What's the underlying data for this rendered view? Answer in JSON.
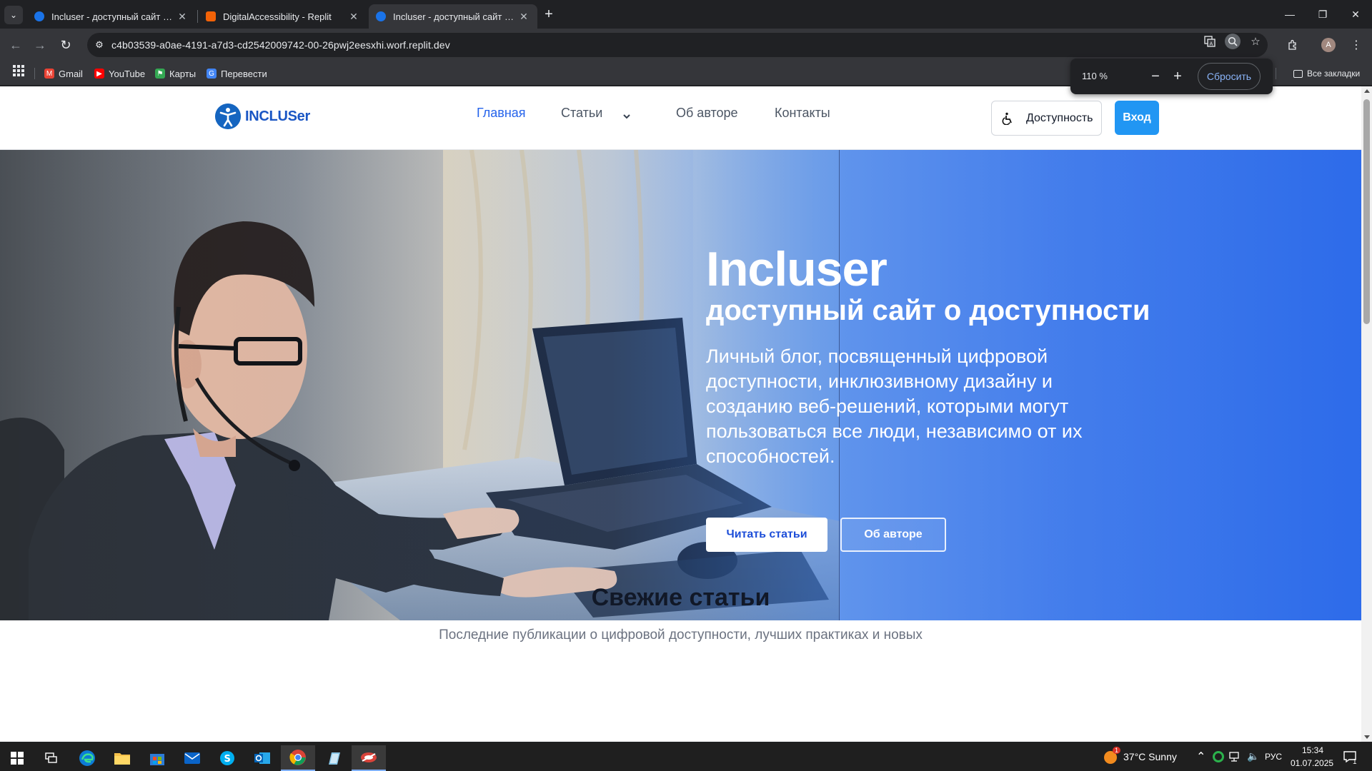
{
  "browser": {
    "tabs": [
      {
        "title": "Incluser - доступный сайт о до...",
        "active": false
      },
      {
        "title": "DigitalAccessibility - Replit",
        "active": false
      },
      {
        "title": "Incluser - доступный сайт о до...",
        "active": true
      }
    ],
    "url": "c4b03539-a0ae-4191-a7d3-cd2542009742-00-26pwj2eesxhi.worf.replit.dev",
    "bookmarks": [
      {
        "label": "Gmail",
        "icon": "gmail-icon"
      },
      {
        "label": "YouTube",
        "icon": "youtube-icon"
      },
      {
        "label": "Карты",
        "icon": "maps-icon"
      },
      {
        "label": "Перевести",
        "icon": "translate-icon"
      }
    ],
    "all_bookmarks_label": "Все закладки",
    "profile_initial": "A",
    "zoom_popup": {
      "value": "110 %",
      "reset_label": "Сбросить"
    }
  },
  "site": {
    "logo_text": "INCLUSer",
    "nav": [
      {
        "label": "Главная",
        "active": true
      },
      {
        "label": "Статьи",
        "active": false
      },
      {
        "label": "Об авторе",
        "active": false
      },
      {
        "label": "Контакты",
        "active": false
      }
    ],
    "accessibility_label": "Доступность",
    "login_label": "Вход",
    "hero": {
      "title": "Incluser",
      "subtitle": "доступный сайт о доступности",
      "description": "Личный блог, посвященный цифровой доступности, инклюзивному дизайну и созданию веб-решений, которыми могут пользоваться все люди, независимо от их способностей.",
      "primary_button": "Читать статьи",
      "secondary_button": "Об авторе"
    },
    "fresh": {
      "title": "Свежие статьи",
      "description": "Последние публикации о цифровой доступности, лучших практиках и новых"
    }
  },
  "taskbar": {
    "weather": "37°C  Sunny",
    "weather_badge": "1",
    "language": "РУС",
    "time": "15:34",
    "date": "01.07.2025",
    "notification_count": "1"
  },
  "colors": {
    "brand_blue": "#2563eb",
    "login_blue": "#2196f3",
    "chrome_dark": "#202124",
    "chrome_toolbar": "#35363a"
  }
}
